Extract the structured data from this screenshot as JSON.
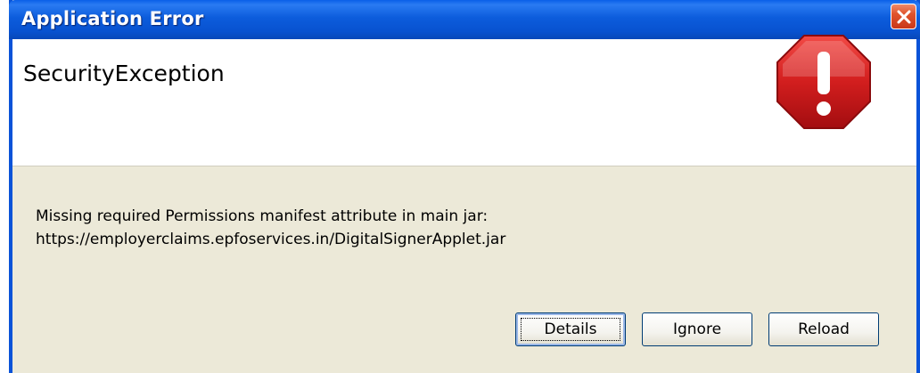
{
  "window": {
    "title": "Application Error",
    "close_icon": "close-icon"
  },
  "header": {
    "heading": "SecurityException",
    "icon": "stop-error-icon"
  },
  "message": {
    "line1": "Missing required Permissions manifest attribute in main jar:",
    "line2": "https://employerclaims.epfoservices.in/DigitalSignerApplet.jar"
  },
  "buttons": {
    "details": "Details",
    "ignore": "Ignore",
    "reload": "Reload"
  },
  "colors": {
    "titlebar": "#0a5fe8",
    "body_bg": "#ece9d8",
    "stop_red": "#c4161c",
    "close_red": "#e0532c"
  }
}
